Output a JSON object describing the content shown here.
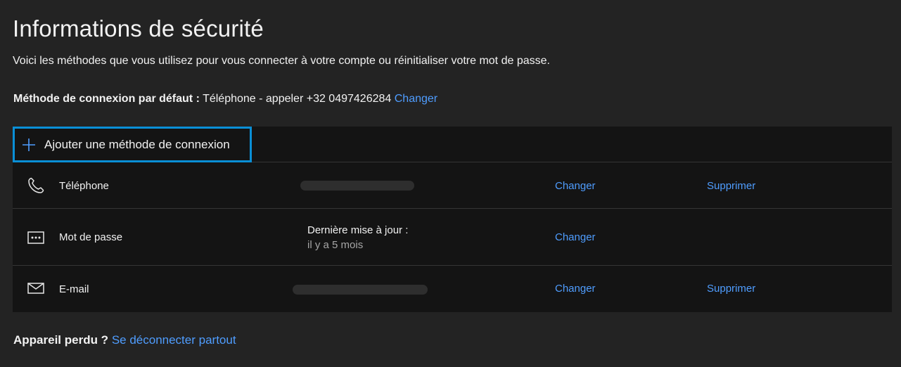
{
  "page": {
    "title": "Informations de sécurité",
    "description": "Voici les méthodes que vous utilisez pour vous connecter à votre compte ou réinitialiser votre mot de passe."
  },
  "default_method": {
    "label": "Méthode de connexion par défaut :",
    "value": "Téléphone - appeler +32 0497426284",
    "change_link": "Changer"
  },
  "add_method": {
    "label": "Ajouter une méthode de connexion",
    "icon": "plus-icon"
  },
  "methods": [
    {
      "name": "Téléphone",
      "icon": "phone-icon",
      "change": "Changer",
      "delete": "Supprimer"
    },
    {
      "name": "Mot de passe",
      "icon": "password-icon",
      "detail_title": "Dernière mise à jour :",
      "detail_sub": "il y a 5 mois",
      "change": "Changer"
    },
    {
      "name": "E-mail",
      "icon": "mail-icon",
      "change": "Changer",
      "delete": "Supprimer"
    }
  ],
  "lost_device": {
    "label": "Appareil perdu ?",
    "link": "Se déconnecter partout"
  },
  "colors": {
    "background": "#232323",
    "panel": "#141414",
    "link": "#4f9dff",
    "focus_border": "#0a8fd6"
  }
}
